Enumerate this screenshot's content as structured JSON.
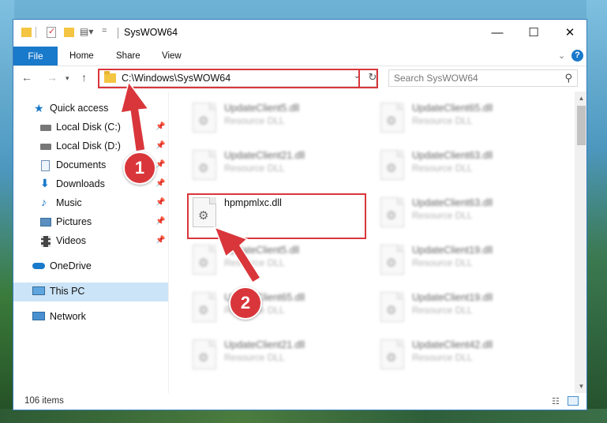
{
  "window": {
    "title": "SysWOW64"
  },
  "titlebar": {
    "minimize": "—",
    "maximize": "☐",
    "close": "✕"
  },
  "ribbon": {
    "file": "File",
    "tabs": [
      "Home",
      "Share",
      "View"
    ]
  },
  "address": {
    "path": "C:\\Windows\\SysWOW64",
    "search_placeholder": "Search SysWOW64"
  },
  "sidebar": {
    "items": [
      {
        "label": "Quick access",
        "icon": "star-icon"
      },
      {
        "label": "Local Disk (C:)",
        "icon": "drive-icon"
      },
      {
        "label": "Local Disk (D:)",
        "icon": "drive-icon"
      },
      {
        "label": "Documents",
        "icon": "documents-icon"
      },
      {
        "label": "Downloads",
        "icon": "downloads-icon"
      },
      {
        "label": "Music",
        "icon": "music-icon"
      },
      {
        "label": "Pictures",
        "icon": "pictures-icon"
      },
      {
        "label": "Videos",
        "icon": "videos-icon"
      },
      {
        "label": "OneDrive",
        "icon": "cloud-icon"
      },
      {
        "label": "This PC",
        "icon": "computer-icon"
      },
      {
        "label": "Network",
        "icon": "network-icon"
      }
    ]
  },
  "files": {
    "left": [
      {
        "name": "UpdateClient5.dll",
        "type": "Resource DLL"
      },
      {
        "name": "UpdateClient21.dll",
        "type": "Resource DLL"
      },
      {
        "name": "hpmpmlxc.dll",
        "type": ""
      },
      {
        "name": "UpdateClient5.dll",
        "type": "Resource DLL"
      },
      {
        "name": "UpdateClient65.dll",
        "type": "Resource DLL"
      },
      {
        "name": "UpdateClient21.dll",
        "type": "Resource DLL"
      }
    ],
    "right": [
      {
        "name": "UpdateClient65.dll",
        "type": "Resource DLL"
      },
      {
        "name": "UpdateClient63.dll",
        "type": "Resource DLL"
      },
      {
        "name": "UpdateClient63.dll",
        "type": "Resource DLL"
      },
      {
        "name": "UpdateClient19.dll",
        "type": "Resource DLL"
      },
      {
        "name": "UpdateClient19.dll",
        "type": "Resource DLL"
      },
      {
        "name": "UpdateClient42.dll",
        "type": "Resource DLL"
      }
    ]
  },
  "status": {
    "count": "106 items"
  },
  "annotations": {
    "step1": "1",
    "step2": "2",
    "accent": "#d9363b"
  }
}
